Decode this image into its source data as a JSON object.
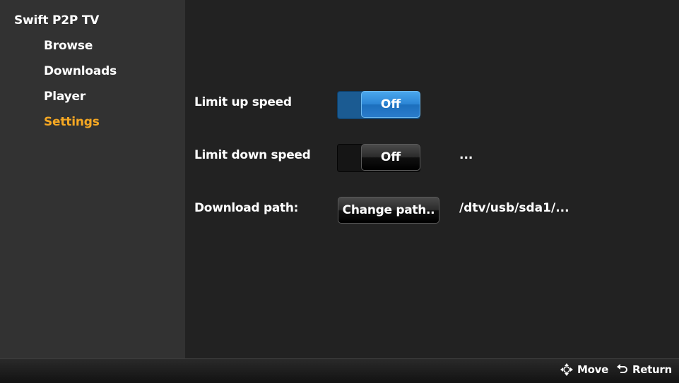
{
  "app": {
    "title": "Swift P2P TV"
  },
  "sidebar": {
    "items": [
      {
        "label": "Browse",
        "active": false
      },
      {
        "label": "Downloads",
        "active": false
      },
      {
        "label": "Player",
        "active": false
      },
      {
        "label": "Settings",
        "active": true
      }
    ]
  },
  "settings": {
    "limit_up": {
      "label": "Limit up speed",
      "toggle": "Off",
      "focused": true
    },
    "limit_down": {
      "label": "Limit down speed",
      "toggle": "Off",
      "value": "..."
    },
    "download_path": {
      "label": "Download path:",
      "button": "Change path..",
      "value": "/dtv/usb/sda1/..."
    }
  },
  "footer": {
    "move": {
      "label": "Move",
      "icon": "move-arrows-icon"
    },
    "return": {
      "label": "Return",
      "icon": "return-arrow-icon"
    }
  },
  "colors": {
    "accent": "#f6a823",
    "focus_blue": "#2c86d6",
    "sidebar_bg": "#323232",
    "main_bg": "#222222"
  }
}
